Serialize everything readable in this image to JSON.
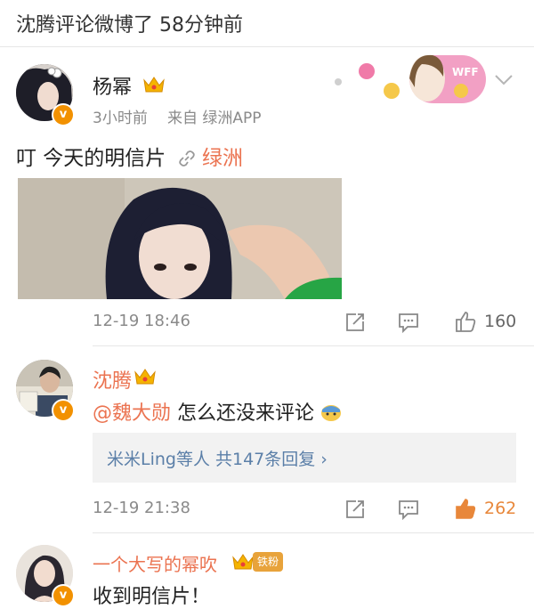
{
  "topbar": {
    "text": "沈腾评论微博了 58分钟前"
  },
  "post": {
    "author": "杨幂",
    "time": "3小时前",
    "source": "来自 绿洲APP",
    "text": "叮 今天的明信片",
    "link_text": "绿洲",
    "banner_text": "WFF"
  },
  "comments": [
    {
      "author": "沈腾",
      "timestamp": "12-19 18:46",
      "like_count": "160",
      "mention": "@魏大勋",
      "text": "怎么还没来评论",
      "replies_summary": "米米Ling等人 共147条回复 ›"
    },
    {
      "timestamp": "12-19 21:38",
      "like_count": "262",
      "like_color": "#e8873a"
    }
  ],
  "third_comment": {
    "author": "一个大写的幂吹",
    "badge": "铁粉",
    "text": "收到明信片！"
  },
  "colors": {
    "accent": "#eb7350",
    "meta": "#8a8a8a",
    "vip": "#f29100"
  },
  "icons": [
    "chevron-down-icon",
    "repost-icon",
    "comment-icon",
    "like-icon",
    "verified-icon",
    "crown-icon",
    "link-icon",
    "emoji-icon"
  ]
}
